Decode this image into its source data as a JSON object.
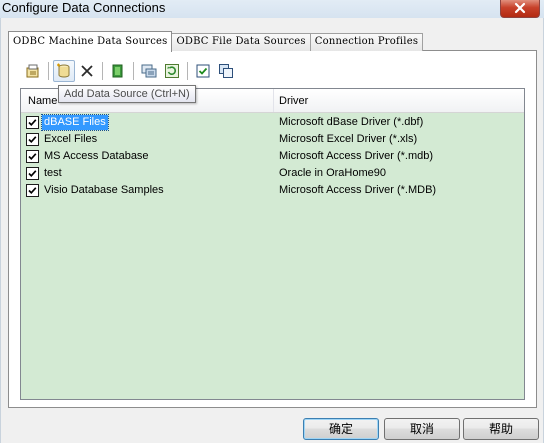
{
  "window": {
    "title": "Configure Data Connections"
  },
  "tabs": [
    {
      "label": "ODBC Machine Data Sources",
      "active": true
    },
    {
      "label": "ODBC File Data Sources",
      "active": false
    },
    {
      "label": "Connection Profiles",
      "active": false
    }
  ],
  "toolbar": {
    "buttons": [
      {
        "icon": "properties-icon"
      },
      {
        "icon": "add-data-source-icon",
        "pressed": true
      },
      {
        "icon": "delete-icon"
      },
      {
        "icon": "connect-icon"
      },
      {
        "icon": "configure-icon"
      },
      {
        "icon": "refresh-icon"
      },
      {
        "icon": "select-all-icon"
      },
      {
        "icon": "copy-icon"
      }
    ]
  },
  "tooltip": {
    "text": "Add Data Source (Ctrl+N)"
  },
  "list": {
    "columns": {
      "name": "Name",
      "driver": "Driver"
    },
    "rows": [
      {
        "name": "dBASE Files",
        "driver": "Microsoft dBase Driver (*.dbf)",
        "checked": true,
        "selected": true
      },
      {
        "name": "Excel Files",
        "driver": "Microsoft Excel Driver (*.xls)",
        "checked": true,
        "selected": false
      },
      {
        "name": "MS Access Database",
        "driver": "Microsoft Access Driver (*.mdb)",
        "checked": true,
        "selected": false
      },
      {
        "name": "test",
        "driver": "Oracle in OraHome90",
        "checked": true,
        "selected": false
      },
      {
        "name": "Visio Database Samples",
        "driver": "Microsoft Access Driver (*.MDB)",
        "checked": true,
        "selected": false
      }
    ],
    "background_color": "#d3ead3"
  },
  "buttons": {
    "ok": "确定",
    "cancel": "取消",
    "help": "帮助"
  },
  "colors": {
    "selection": "#3399ff",
    "close_button": "#c7412a"
  }
}
